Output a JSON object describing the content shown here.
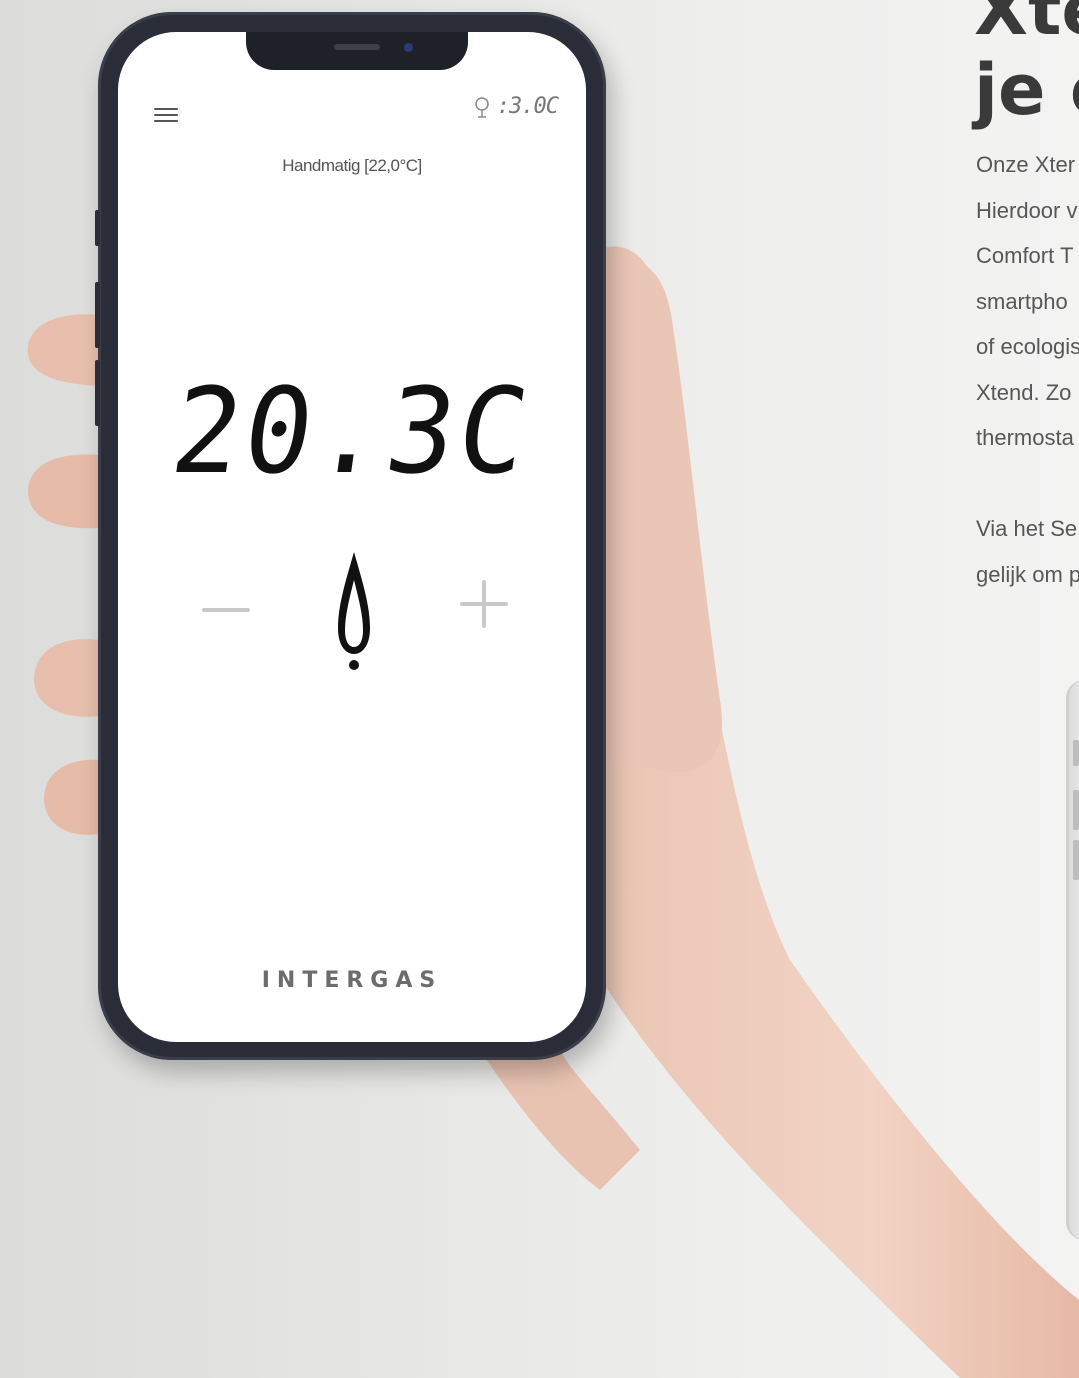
{
  "phone": {
    "outdoor_temp": ":3.0C",
    "mode_label": "Handmatig [22,0°C]",
    "temperature": "20.3C",
    "brand": "INTERGAS",
    "icons": [
      "menu-icon",
      "outdoor-temperature-icon",
      "flame-icon",
      "minus-icon",
      "plus-icon"
    ]
  },
  "right_column": {
    "heading_line1": "Xter",
    "heading_line2": "je c",
    "paragraph1": [
      "Onze Xter",
      "Hierdoor v",
      "Comfort T",
      "smartpho",
      "of ecologis",
      "Xtend. Zo",
      "thermosta"
    ],
    "paragraph2": [
      "Via het Se",
      "gelijk om p"
    ]
  },
  "colors": {
    "phone_frame": "#2a2d38",
    "text_dark": "#3a3a3a",
    "text_body": "#575757",
    "button_gray": "#c9c9c9"
  }
}
